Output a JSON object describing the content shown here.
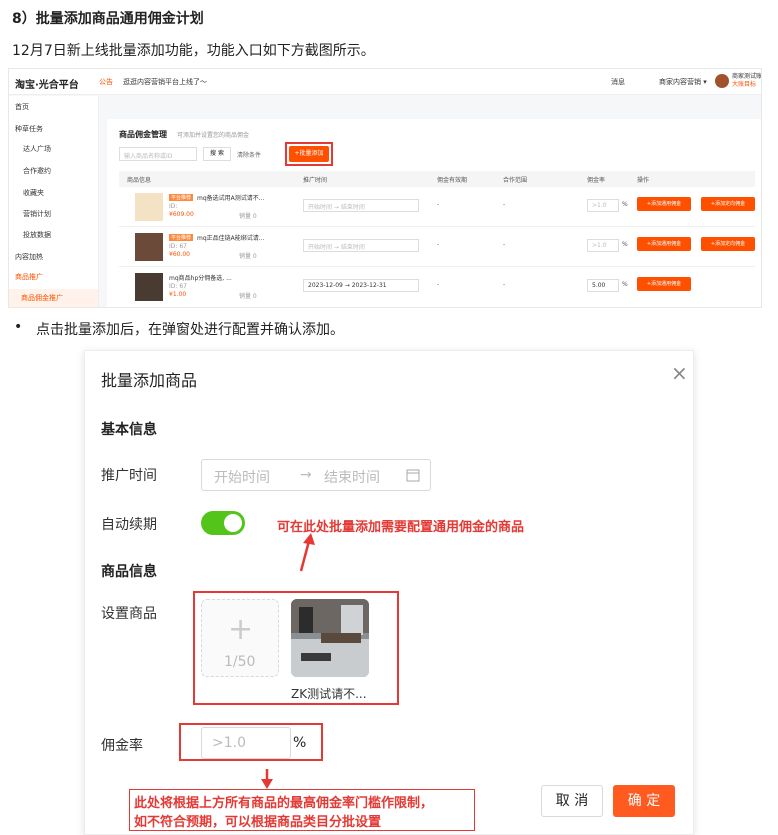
{
  "heading": "8）批量添加商品通用佣金计划",
  "intro": "12月7日新上线批量添加功能，功能入口如下方截图所示。",
  "shot1": {
    "logo": "淘宝·光合平台",
    "notice_tag": "公告",
    "notice": "逛逛内容营销平台上线了～",
    "msg": "消息",
    "shop": "商家内容营销 ▾",
    "user_name": "商家测试账",
    "user_sub": "大账目标",
    "sidebar": [
      "首页",
      "种草任务",
      "达人广场",
      "合作邀约",
      "收藏夹",
      "营销计划",
      "投放数据",
      "内容加热",
      "商品推广",
      "商品佣金推广"
    ],
    "panel_title": "商品佣金管理",
    "panel_hint": "可添加并设置您的商品佣金",
    "search_placeholder": "输入商品名称或ID",
    "search_btn": "搜 索",
    "clear_btn": "清除条件",
    "add_btn": "+批量添加",
    "columns": [
      "商品信息",
      "推广时间",
      "佣金有效期",
      "合作范围",
      "佣金率",
      "操作"
    ],
    "rows": [
      {
        "tag": "平台推荐",
        "name": "mq备选试用A测试请不...",
        "id": "ID: ",
        "price": "¥609.00",
        "sales": "销量 0",
        "time": "开始时间  →  结束时间",
        "d1": "-",
        "d2": "-",
        "rate": ">1.0",
        "pct": "%",
        "b1": "+添加通用佣金",
        "b2": "+添加定向佣金"
      },
      {
        "tag": "平台推荐",
        "name": "mq正品佳链A能绑试请...",
        "id": "ID: 67",
        "price": "¥60.00",
        "sales": "销量 0",
        "time": "开始时间  →  结束时间",
        "d1": "-",
        "d2": "-",
        "rate": ">1.0",
        "pct": "%",
        "b1": "+添加通用佣金",
        "b2": "+添加定向佣金"
      },
      {
        "tag": "",
        "name": "mq商品hp分佣备选, ...",
        "id": "ID: 67",
        "price": "¥1.00",
        "sales": "销量 0",
        "time": "2023-12-09  →  2023-12-31",
        "d1": "-",
        "d2": "-",
        "rate": "5.00",
        "pct": "%",
        "b1": "+添加通用佣金",
        "b2": ""
      }
    ]
  },
  "bullet_text": "点击批量添加后，在弹窗处进行配置并确认添加。",
  "modal": {
    "title": "批量添加商品",
    "close": "×",
    "section_basic": "基本信息",
    "label_time": "推广时间",
    "start_placeholder": "开始时间",
    "arrow": "→",
    "end_placeholder": "结束时间",
    "label_renew": "自动续期",
    "note_products": "可在此处批量添加需要配置通用佣金的商品",
    "section_goods": "商品信息",
    "label_set": "设置商品",
    "upload_plus": "+",
    "upload_count": "1/50",
    "product_name": "ZK测试请不...",
    "label_rate": "佣金率",
    "rate_placeholder": ">1.0",
    "rate_unit": "%",
    "note_rate_1": "此处将根据上方所有商品的最高佣金率门槛作限制，",
    "note_rate_2": "如不符合预期，可以根据商品类目分批设置",
    "cancel": "取 消",
    "confirm": "确 定"
  },
  "colors": {
    "accent": "#ff5000",
    "annotation": "#e53935",
    "toggle": "#52c41a"
  }
}
